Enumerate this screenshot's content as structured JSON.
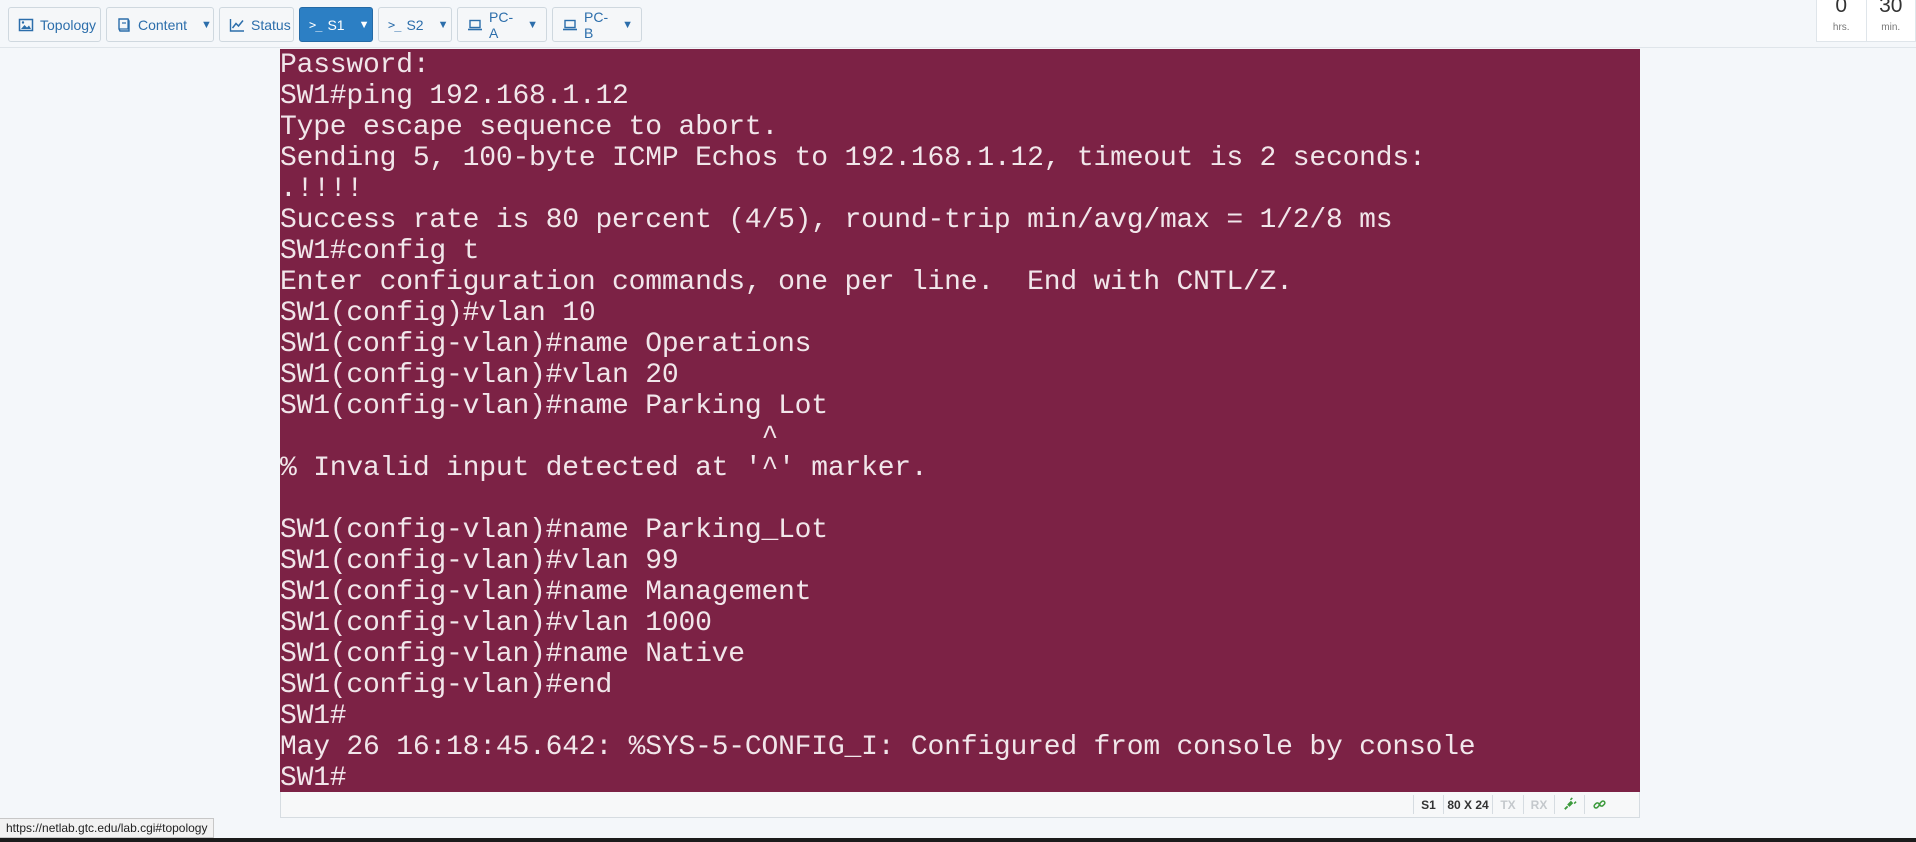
{
  "toolbar": {
    "tabs": [
      {
        "label": "Topology",
        "icon": "image-icon",
        "dropdown": false,
        "active": false
      },
      {
        "label": "Content",
        "icon": "book-icon",
        "dropdown": true,
        "active": false
      },
      {
        "label": "Status",
        "icon": "line-chart-icon",
        "dropdown": false,
        "active": false
      },
      {
        "label": "S1",
        "icon": "terminal-prompt-icon",
        "dropdown": true,
        "active": true
      },
      {
        "label": "S2",
        "icon": "terminal-prompt-icon",
        "dropdown": true,
        "active": false
      },
      {
        "label": "PC-A",
        "icon": "laptop-icon",
        "dropdown": true,
        "active": false
      },
      {
        "label": "PC-B",
        "icon": "laptop-icon",
        "dropdown": true,
        "active": false
      }
    ],
    "prompt_glyph": ">_"
  },
  "timer": {
    "hours": "0",
    "hours_unit": "hrs.",
    "minutes": "30",
    "minutes_unit": "min."
  },
  "terminal": {
    "lines": [
      "Password:",
      "SW1#ping 192.168.1.12",
      "Type escape sequence to abort.",
      "Sending 5, 100-byte ICMP Echos to 192.168.1.12, timeout is 2 seconds:",
      ".!!!!",
      "Success rate is 80 percent (4/5), round-trip min/avg/max = 1/2/8 ms",
      "SW1#config t",
      "Enter configuration commands, one per line.  End with CNTL/Z.",
      "SW1(config)#vlan 10",
      "SW1(config-vlan)#name Operations",
      "SW1(config-vlan)#vlan 20",
      "SW1(config-vlan)#name Parking Lot",
      "                             ^",
      "% Invalid input detected at '^' marker.",
      "",
      "SW1(config-vlan)#name Parking_Lot",
      "SW1(config-vlan)#vlan 99",
      "SW1(config-vlan)#name Management",
      "SW1(config-vlan)#vlan 1000",
      "SW1(config-vlan)#name Native",
      "SW1(config-vlan)#end",
      "SW1#",
      "May 26 16:18:45.642: %SYS-5-CONFIG_I: Configured from console by console",
      "SW1#"
    ],
    "colors": {
      "background": "#7c2245",
      "text": "#f1e6ea"
    }
  },
  "status_bar": {
    "device": "S1",
    "size": "80 X 24",
    "tx": "TX",
    "rx": "RX",
    "icons": [
      "plug-icon",
      "link-icon"
    ]
  },
  "url_hint": "https://netlab.gtc.edu/lab.cgi#topology",
  "colors": {
    "accent": "#2c7fc4",
    "link": "#2c6eab",
    "plug_green": "#3c9a3c"
  }
}
